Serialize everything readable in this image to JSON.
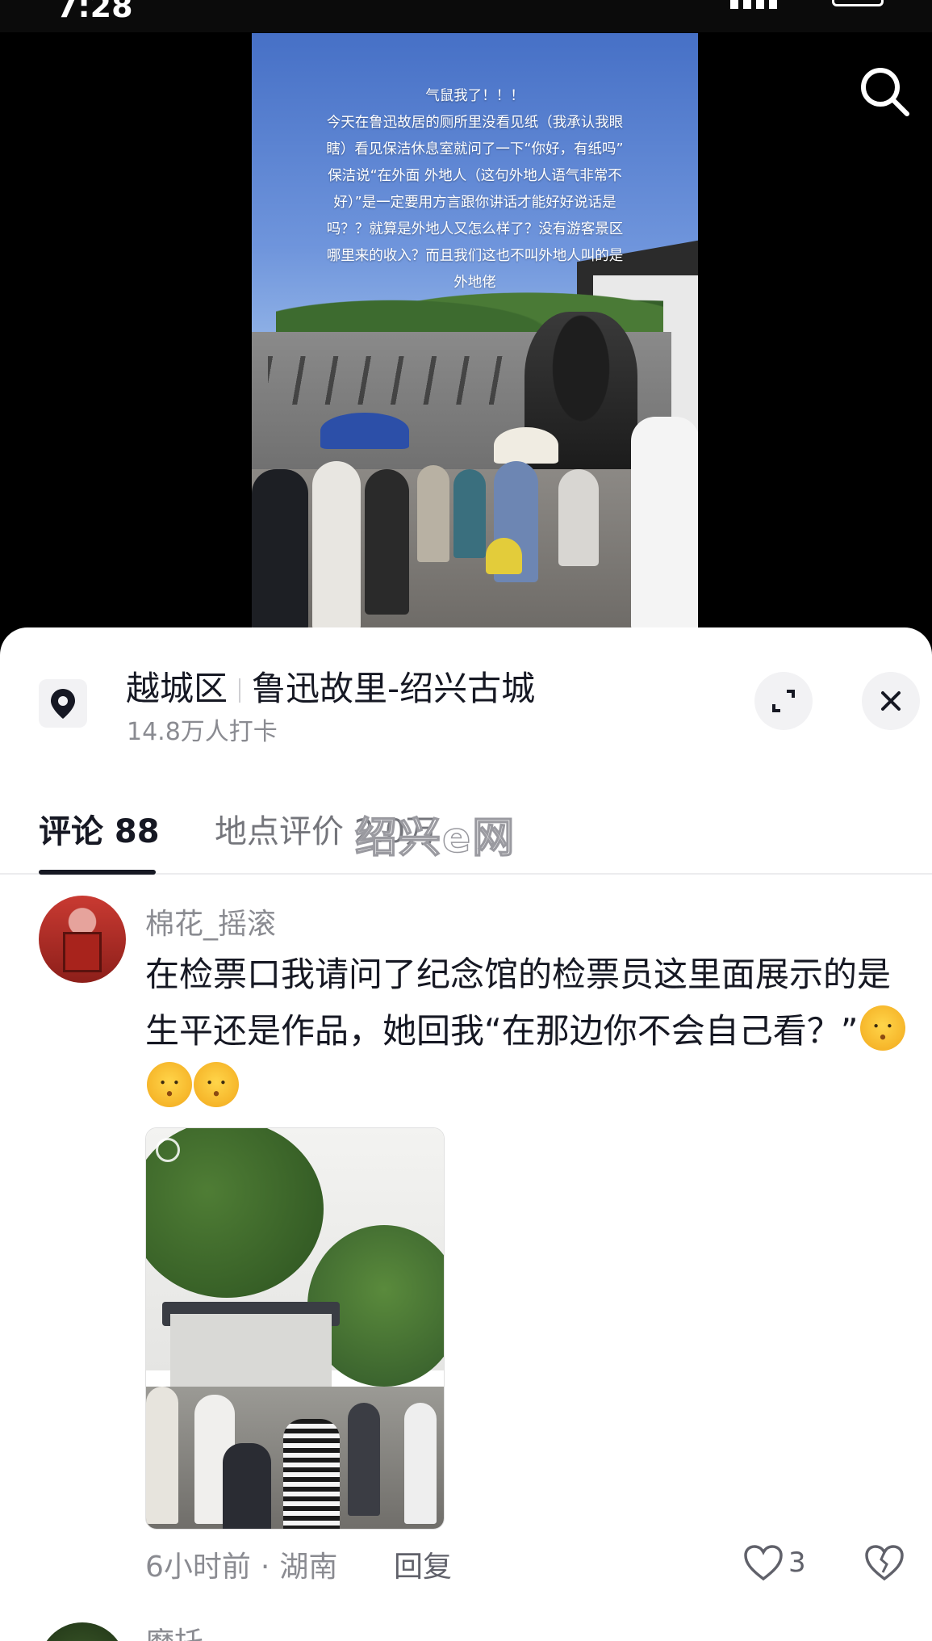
{
  "status_bar": {
    "time": "7:28"
  },
  "video": {
    "overlay_lines": [
      "气鼠我了！！！",
      "今天在鲁迅故居的厕所里没看见纸（我承认我眼",
      "瞎）看见保洁休息室就问了一下“你好，有纸吗”",
      "保洁说“在外面 外地人（这句外地人语气非常不",
      "好）”是一定要用方言跟你讲话才能好好说话是",
      "吗？？就算是外地人又怎么样了？没有游客景区",
      "哪里来的收入？而且我们这也不叫外地人叫的是",
      "外地佬"
    ]
  },
  "location": {
    "district": "越城区",
    "name": "鲁迅故里-绍兴古城",
    "checkins": "14.8万人打卡"
  },
  "tabs": {
    "comments": "评论 88",
    "reviews": "地点评价 2.0万"
  },
  "watermark": "绍兴e网",
  "comment": {
    "username": "棉花_摇滚",
    "text": "在检票口我请问了纪念馆的检票员这里面展示的是生平还是作品，她回我“在那边你不会自己看？”",
    "time": "6小时前",
    "region": "湖南",
    "reply_label": "回复",
    "like_count": "3"
  },
  "next_comment": {
    "username": "磨托"
  },
  "icons": {
    "search": "search-icon",
    "location": "location-pin-icon",
    "expand": "expand-icon",
    "close": "close-icon",
    "like": "heart-icon",
    "dislike": "broken-heart-icon"
  },
  "colors": {
    "text_primary": "#161823",
    "text_secondary": "#8a8b91",
    "sheet_bg": "#ffffff"
  }
}
